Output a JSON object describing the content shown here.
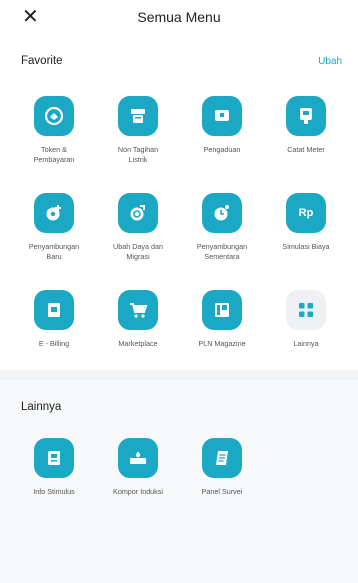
{
  "header": {
    "close_icon": "close-icon",
    "close_glyph": "✕",
    "title": "Semua Menu"
  },
  "favorite": {
    "title": "Favorite",
    "edit_label": "Ubah",
    "rows": [
      [
        {
          "label": "Token &\nPembayaran",
          "icon": "token-payment-icon"
        },
        {
          "label": "Non Tagihan\nListrik",
          "icon": "non-bill-icon"
        },
        {
          "label": "Pengaduan",
          "icon": "complaint-icon"
        },
        {
          "label": "Catat Meter",
          "icon": "meter-record-icon"
        }
      ],
      [
        {
          "label": "Penyambungan\nBaru",
          "icon": "new-connection-icon"
        },
        {
          "label": "Ubah Daya dan\nMigrasi",
          "icon": "change-power-icon"
        },
        {
          "label": "Penyambungan\nSementara",
          "icon": "temporary-connection-icon"
        },
        {
          "label": "Simulasi Biaya",
          "icon": "cost-simulation-icon",
          "glyph": "Rp"
        }
      ],
      [
        {
          "label": "E - Billing",
          "icon": "e-billing-icon"
        },
        {
          "label": "Marketplace",
          "icon": "marketplace-cart-icon"
        },
        {
          "label": "PLN Magazine",
          "icon": "magazine-icon"
        },
        {
          "label": "Lainnya",
          "icon": "more-grid-icon"
        }
      ]
    ]
  },
  "other": {
    "title": "Lainnya",
    "items": [
      {
        "label": "Info Stimulus",
        "icon": "stimulus-info-icon"
      },
      {
        "label": "Kompor Induksi",
        "icon": "induction-stove-icon"
      },
      {
        "label": "Panel Survei",
        "icon": "survey-panel-icon"
      }
    ]
  },
  "colors": {
    "accent": "#1ba8c4",
    "muted_tile": "#eef0f3"
  }
}
